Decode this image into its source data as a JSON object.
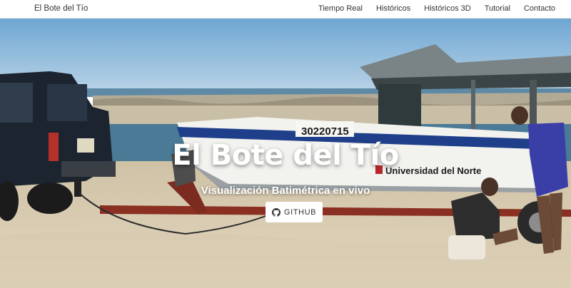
{
  "navbar": {
    "brand": "El Bote del Tío",
    "links": [
      "Tiempo Real",
      "Históricos",
      "Históricos 3D",
      "Tutorial",
      "Contacto"
    ]
  },
  "hero": {
    "title": "El Bote del Tío",
    "subtitle": "Visualización Batimétrica en vivo",
    "github_label": "GITHUB",
    "boat_registration": "30220715",
    "boat_text": "Universidad del Norte"
  },
  "colors": {
    "nav_bg": "#ffffff",
    "nav_text": "#333333",
    "sky": "#7fb3d9",
    "water": "#4f7f99",
    "sand": "#d9ccb4",
    "boat_blue": "#1f3f8a",
    "trailer_red": "#8a2f22"
  }
}
